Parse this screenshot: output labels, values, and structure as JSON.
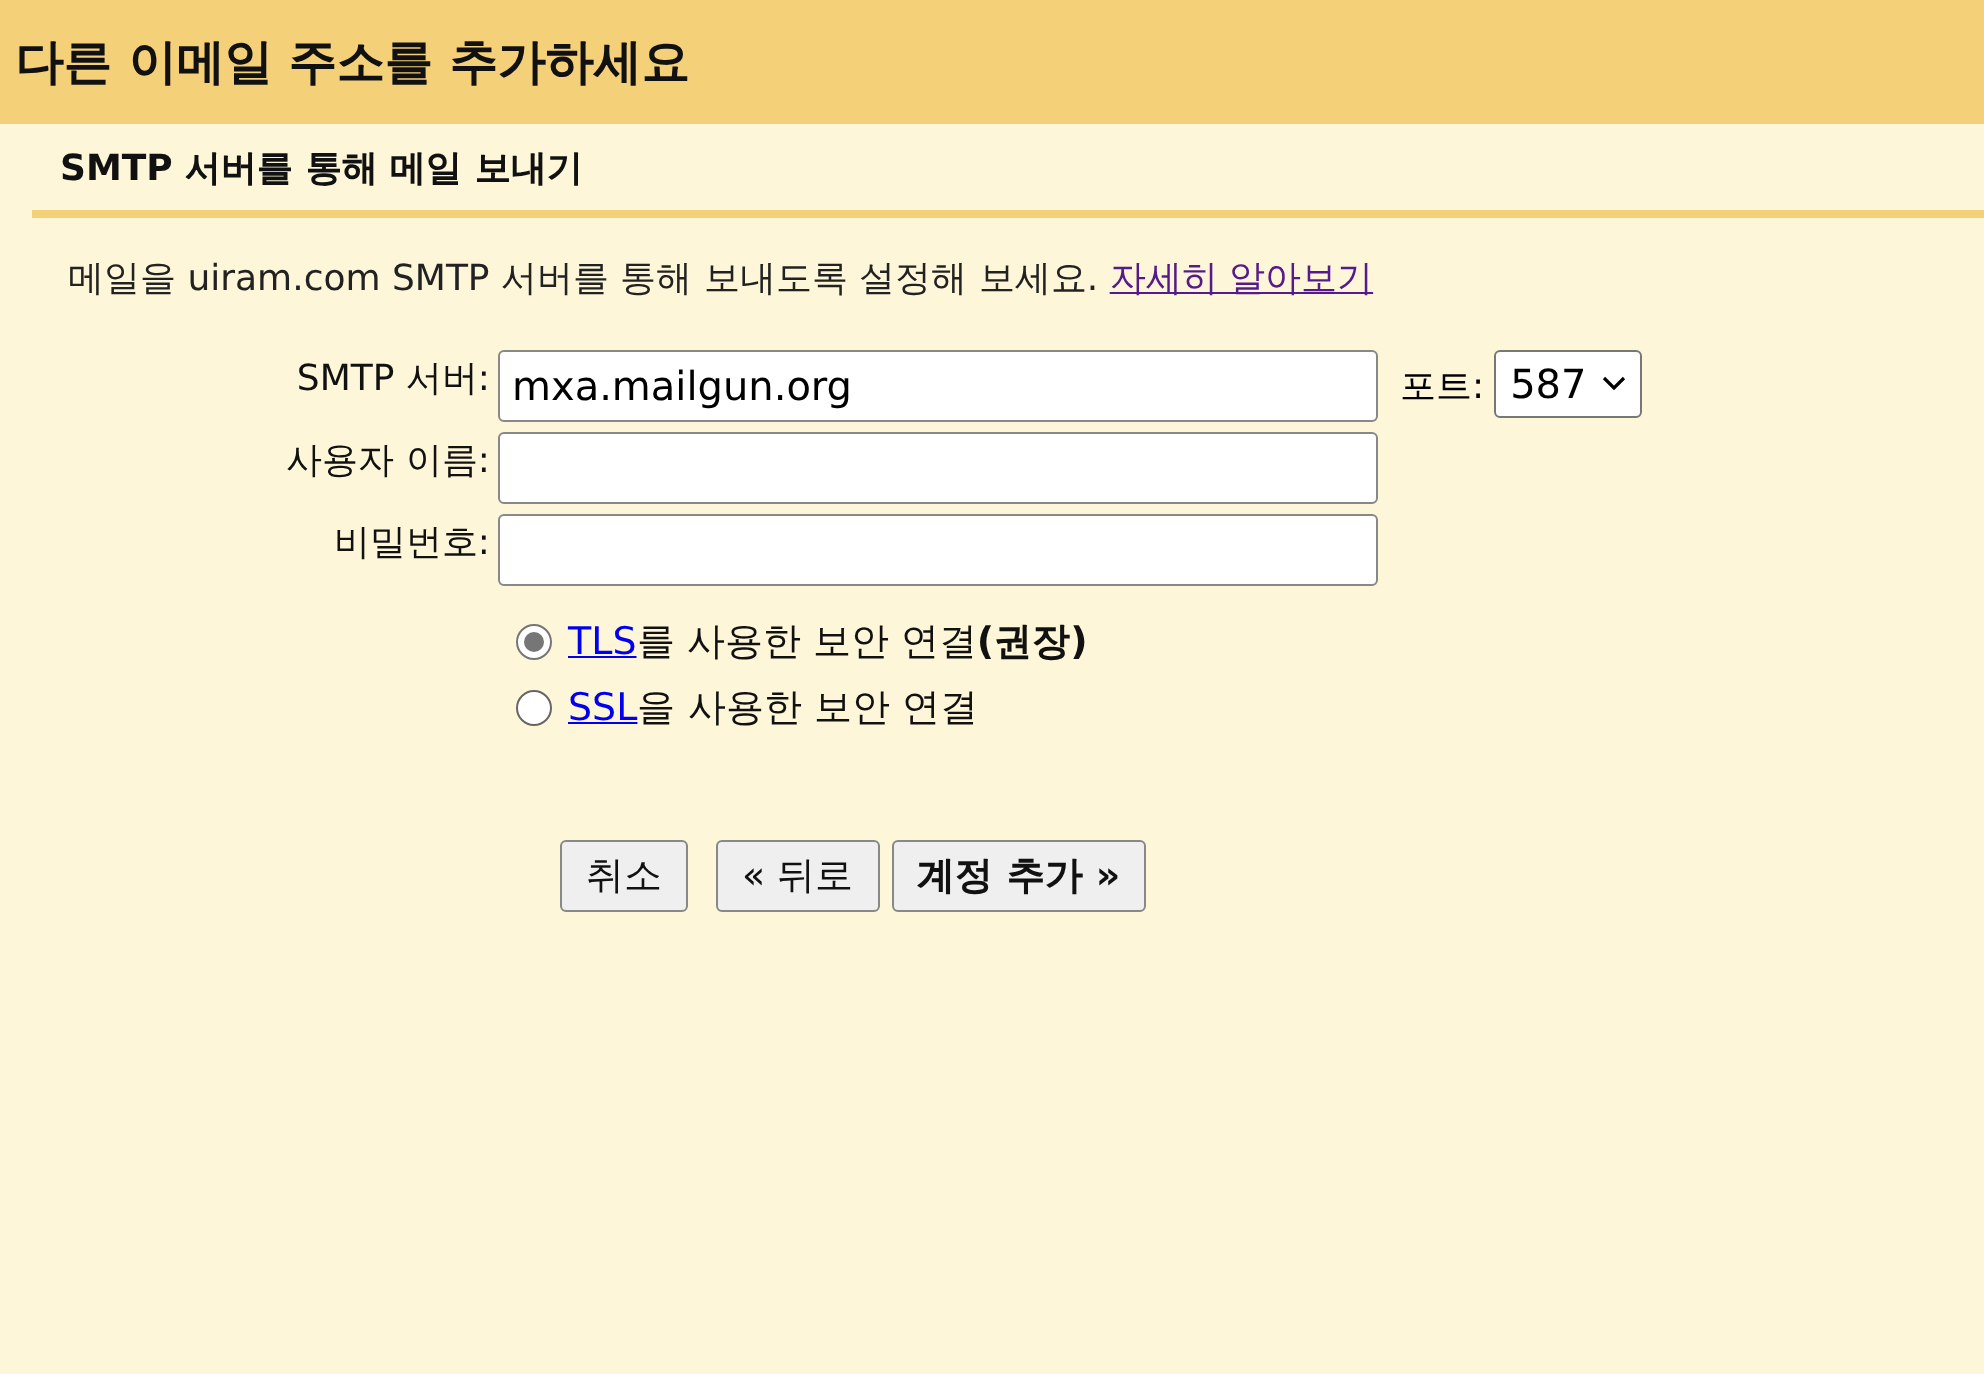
{
  "window": {
    "title": "다른 이메일 주소를 추가하세요"
  },
  "section": {
    "title": "SMTP 서버를 통해 메일 보내기"
  },
  "intro": {
    "text": "메일을 uiram.com SMTP 서버를 통해 보내도록 설정해 보세요.",
    "link": "자세히 알아보기"
  },
  "fields": [
    {
      "label": "SMTP 서버:",
      "value": "mxa.mailgun.org"
    },
    {
      "label": "사용자 이름:"
    },
    {
      "label": "비밀번호:"
    }
  ],
  "port": {
    "label": "포트:",
    "value": "587"
  },
  "security": [
    {
      "link": "TLS",
      "text": "를 사용한 보안 연결**(권장)**",
      "selected": true
    },
    {
      "link": "SSL",
      "text": "을 사용한 보안 연결",
      "selected": false
    }
  ],
  "buttons": [
    {
      "label": "취소",
      "primary": false
    },
    {
      "label": "« 뒤로",
      "primary": false
    },
    {
      "label": "계정 추가 »",
      "primary": true
    }
  ]
}
